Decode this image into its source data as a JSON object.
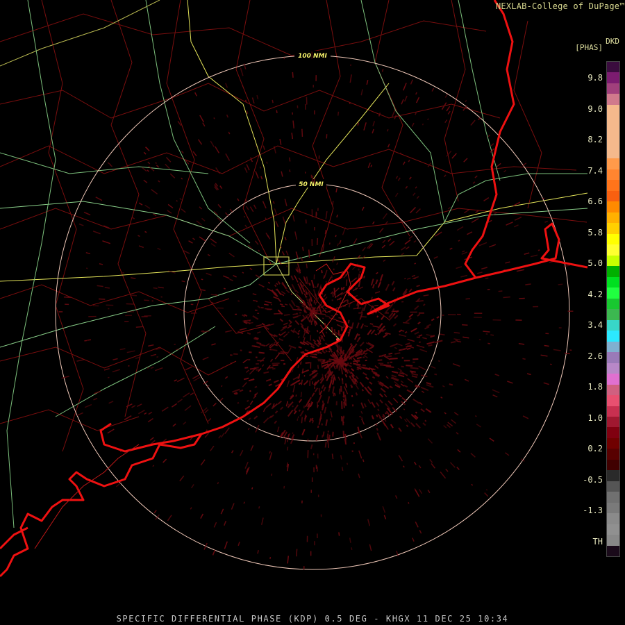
{
  "header": {
    "credit": "NEXLAB-College of DuPage",
    "credit_mark": "™",
    "product_code": "DKD",
    "product_units": "[PHAS]"
  },
  "range_rings": [
    {
      "label": "50 NMI"
    },
    {
      "label": "100 NMI"
    }
  ],
  "colorbar": {
    "labels": [
      "9.8",
      "9.0",
      "8.2",
      "7.4",
      "6.6",
      "5.8",
      "5.0",
      "4.2",
      "3.4",
      "2.6",
      "1.8",
      "1.0",
      "0.2",
      "-0.5",
      "-1.3",
      "TH"
    ],
    "colors": [
      "#3a0c3e",
      "#7c1c70",
      "#a1407c",
      "#d07a8c",
      "#f5b98c",
      "#f5b98c",
      "#f5b98c",
      "#f5b98c",
      "#f5b98c",
      "#ff9a4a",
      "#ff8530",
      "#ff741a",
      "#f86010",
      "#ff8a00",
      "#ffb000",
      "#ffd000",
      "#ffff00",
      "#ffff30",
      "#c8ff00",
      "#00b000",
      "#00e020",
      "#20ff40",
      "#18c830",
      "#3cb850",
      "#38d6c8",
      "#2ce8ff",
      "#80b0d0",
      "#9a7ab8",
      "#b888c8",
      "#e070d0",
      "#d06080",
      "#e85070",
      "#c83050",
      "#a01830",
      "#800010",
      "#700000",
      "#580000",
      "#400000",
      "#2a2a2a",
      "#555555",
      "#707070",
      "#7a7a7a",
      "#8a8a8a",
      "#909090",
      "#888888",
      "#1a0a1a"
    ]
  },
  "footer": {
    "title": "SPECIFIC DIFFERENTIAL PHASE (KDP) 0.5 DEG - KHGX 11 DEC 25 10:34"
  }
}
